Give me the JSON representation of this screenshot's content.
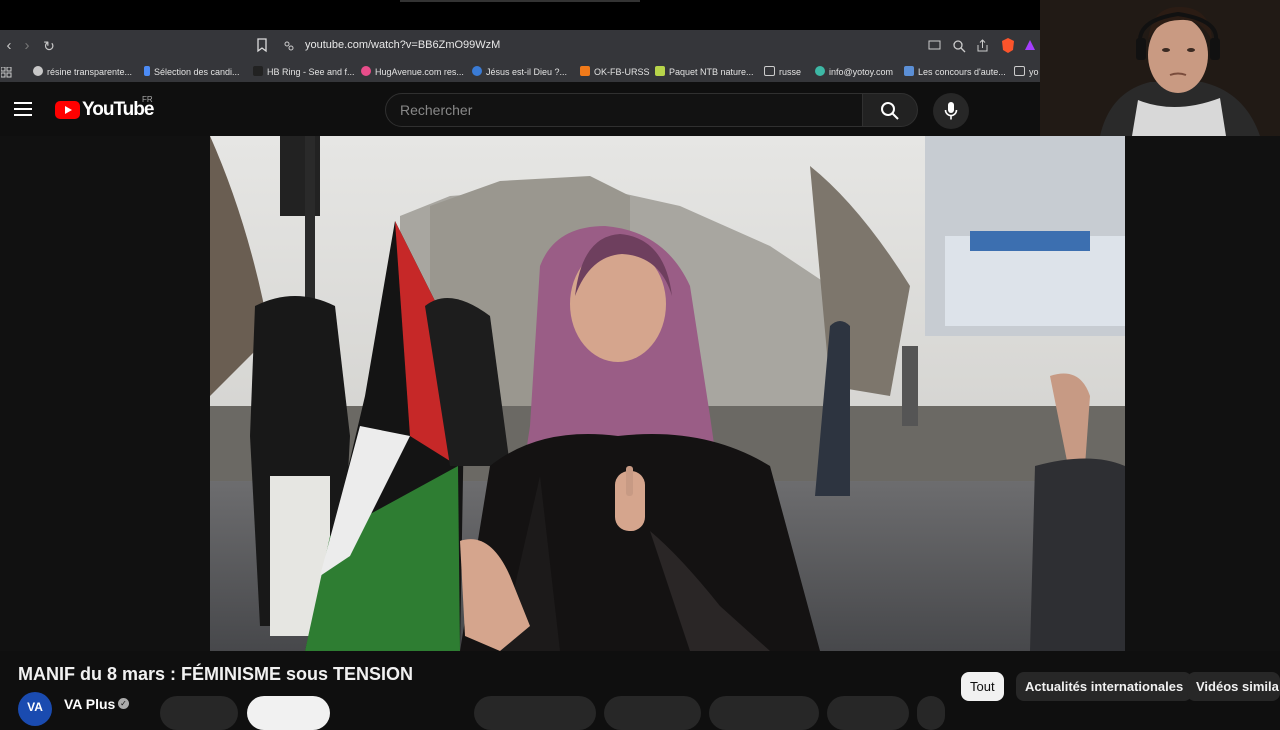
{
  "browser": {
    "url": "youtube.com/watch?v=BB6ZmO99WzM",
    "bookmarks": [
      {
        "label": "résine transparente...",
        "color": "#c8c8c8"
      },
      {
        "label": "Sélection des candi...",
        "color": "#4c8bf5"
      },
      {
        "label": "HB Ring - See and f...",
        "color": "#222222"
      },
      {
        "label": "HugAvenue.com res...",
        "color": "#e84d8a"
      },
      {
        "label": "Jésus est-il Dieu ?...",
        "color": "#3a7bd5"
      },
      {
        "label": "OK-FB-URSS",
        "color": "#f07a1a"
      },
      {
        "label": "Paquet NTB nature...",
        "color": "#b7d44a"
      },
      {
        "label": "russe",
        "color": "#cccccc"
      },
      {
        "label": "info@yotoy.com",
        "color": "#3db8a5"
      },
      {
        "label": "Les concours d'aute...",
        "color": "#5b8fd6"
      },
      {
        "label": "yo",
        "color": "#cccccc"
      }
    ]
  },
  "youtube": {
    "logo_text": "YouTube",
    "region": "FR",
    "search_placeholder": "Rechercher"
  },
  "video": {
    "title": "MANIF du 8 mars : FÉMINISME sous TENSION",
    "channel": "VA Plus",
    "avatar_text": "VA"
  },
  "chips": [
    "Tout",
    "Actualités internationales",
    "Vidéos simila"
  ],
  "colors": {
    "accent": "#ff0000",
    "background": "#0f0f0f"
  }
}
